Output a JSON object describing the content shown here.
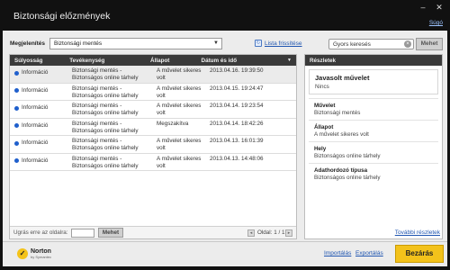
{
  "window": {
    "title": "Biztonsági előzmények",
    "help_label": "Súgó",
    "minimize": "–",
    "close": "✕"
  },
  "filter": {
    "label": "Megjelenítés",
    "selected": "Biztonsági mentés",
    "arrow": "▼"
  },
  "refresh": {
    "label": "Lista frissítése",
    "icon": "refresh-icon"
  },
  "search": {
    "placeholder": "Gyors keresés",
    "value": "Gyors keresés",
    "clear": "×",
    "button": "Mehet"
  },
  "table": {
    "headers": [
      "Súlyosság",
      "Tevékenység",
      "Állapot",
      "Dátum és idő"
    ],
    "sort_icon": "▼",
    "rows": [
      {
        "severity": "Információ",
        "activity": "Biztonsági mentés - Biztonságos online tárhely",
        "status": "A művelet sikeres volt",
        "datetime": "2013.04.16. 19:39:50",
        "selected": true
      },
      {
        "severity": "Információ",
        "activity": "Biztonsági mentés - Biztonságos online tárhely",
        "status": "A művelet sikeres volt",
        "datetime": "2013.04.15. 19:24:47",
        "selected": false
      },
      {
        "severity": "Információ",
        "activity": "Biztonsági mentés - Biztonságos online tárhely",
        "status": "A művelet sikeres volt",
        "datetime": "2013.04.14. 19:23:54",
        "selected": false
      },
      {
        "severity": "Információ",
        "activity": "Biztonsági mentés - Biztonságos online tárhely",
        "status": "Megszakítva",
        "datetime": "2013.04.14. 18:42:26",
        "selected": false
      },
      {
        "severity": "Információ",
        "activity": "Biztonsági mentés - Biztonságos online tárhely",
        "status": "A művelet sikeres volt",
        "datetime": "2013.04.13. 16:01:39",
        "selected": false
      },
      {
        "severity": "Információ",
        "activity": "Biztonsági mentés - Biztonságos online tárhely",
        "status": "A művelet sikeres volt",
        "datetime": "2013.04.13. 14:48:06",
        "selected": false
      }
    ]
  },
  "pager": {
    "label": "Ugrás erre az oldalra:",
    "go_button": "Mehet",
    "prev": "◂",
    "next": "▸",
    "page_info": "Oldal: 1 / 1"
  },
  "details": {
    "header": "Részletek",
    "recommended_title": "Javasolt művelet",
    "recommended_value": "Nincs",
    "fields": [
      {
        "label": "Művelet",
        "value": "Biztonsági mentés"
      },
      {
        "label": "Állapot",
        "value": "A művelet sikeres volt"
      },
      {
        "label": "Hely",
        "value": "Biztonságos online tárhely"
      },
      {
        "label": "Adathordozó típusa",
        "value": "Biztonságos online tárhely"
      }
    ],
    "more_link": "További részletek"
  },
  "footer": {
    "brand": "Norton",
    "brand_sub": "by Symantec",
    "import": "Importálás",
    "export": "Exportálás",
    "close_button": "Bezárás"
  },
  "colors": {
    "accent": "#f3c21b",
    "info_dot": "#1f5fcc",
    "header_bg": "#3a3a3a",
    "link": "#1f55b0"
  }
}
